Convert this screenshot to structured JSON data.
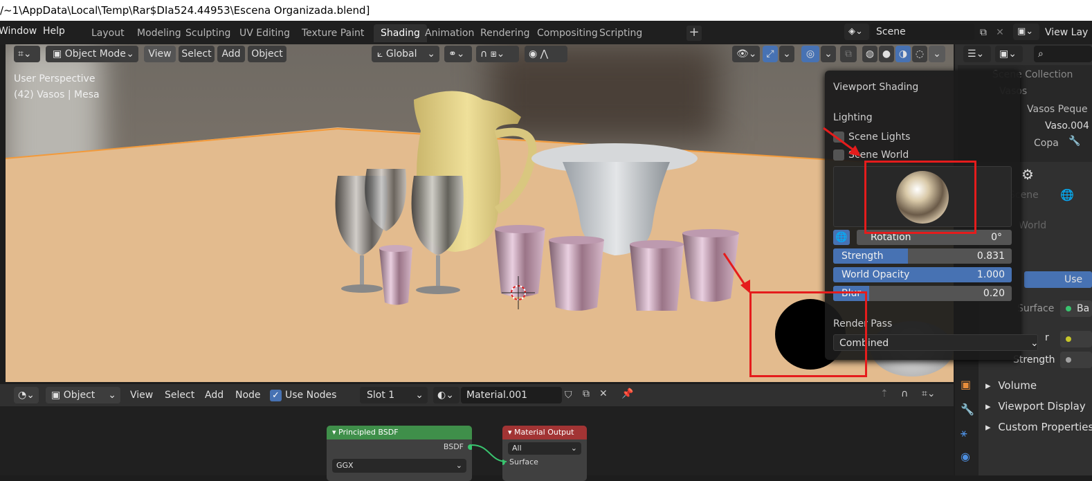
{
  "titlebar": {
    "path": "/~1\\AppData\\Local\\Temp\\Rar$DIa524.44953\\Escena Organizada.blend]"
  },
  "menu": {
    "window": "Window",
    "help": "Help"
  },
  "workspace_tabs": [
    {
      "label": "Layout",
      "active": false
    },
    {
      "label": "Modeling",
      "active": false
    },
    {
      "label": "Sculpting",
      "active": false
    },
    {
      "label": "UV Editing",
      "active": false
    },
    {
      "label": "Texture Paint",
      "active": false
    },
    {
      "label": "Shading",
      "active": true
    },
    {
      "label": "Animation",
      "active": false
    },
    {
      "label": "Rendering",
      "active": false
    },
    {
      "label": "Compositing",
      "active": false
    },
    {
      "label": "Scripting",
      "active": false
    }
  ],
  "add_tab_symbol": "+",
  "scene": {
    "name": "Scene",
    "view_layer": "View Lay"
  },
  "viewport_header": {
    "mode": "Object Mode",
    "view": "View",
    "select": "Select",
    "add": "Add",
    "object": "Object",
    "transform_orientation": "Global"
  },
  "viewport_overlay": {
    "perspective": "User Perspective",
    "selection": "(42) Vasos | Mesa"
  },
  "viewport_shading": {
    "title": "Viewport Shading",
    "lighting_label": "Lighting",
    "scene_lights": "Scene Lights",
    "scene_world": "Scene World",
    "rotation_label": "Rotation",
    "rotation_value": "0°",
    "strength_label": "Strength",
    "strength_value": "0.831",
    "strength_fill": 0.42,
    "opacity_label": "World Opacity",
    "opacity_value": "1.000",
    "opacity_fill": 1.0,
    "blur_label": "Blur",
    "blur_value": "0.20",
    "blur_fill": 0.2,
    "render_pass_label": "Render Pass",
    "render_pass_value": "Combined"
  },
  "outliner": {
    "scene_collection": "Scene Collection",
    "vasos": "Vasos",
    "vasos_peque": "Vasos Peque",
    "vaso004": "Vaso.004",
    "copa": "Copa"
  },
  "properties": {
    "scene_label": "Scene",
    "world_label": "World",
    "use_btn": "Use",
    "surface_label": "Surface",
    "surface_value": "Ba",
    "color_label": "r",
    "strength_label": "Strength",
    "volume": "Volume",
    "viewport_display": "Viewport Display",
    "custom_properties": "Custom Properties"
  },
  "node_header": {
    "editor_type": "Object",
    "view": "View",
    "select": "Select",
    "add": "Add",
    "node": "Node",
    "use_nodes": "Use Nodes",
    "slot": "Slot 1",
    "material": "Material.001"
  },
  "nodes": {
    "principled": {
      "title": "Principled BSDF",
      "output": "BSDF",
      "distribution": "GGX"
    },
    "output": {
      "title": "Material Output",
      "target": "All",
      "surface": "Surface"
    }
  },
  "colors": {
    "accent": "#4772b3",
    "annotation": "#e51c1c",
    "table": "#e3bb8e",
    "principled_header": "#3f8f4a",
    "output_header": "#a23434"
  }
}
